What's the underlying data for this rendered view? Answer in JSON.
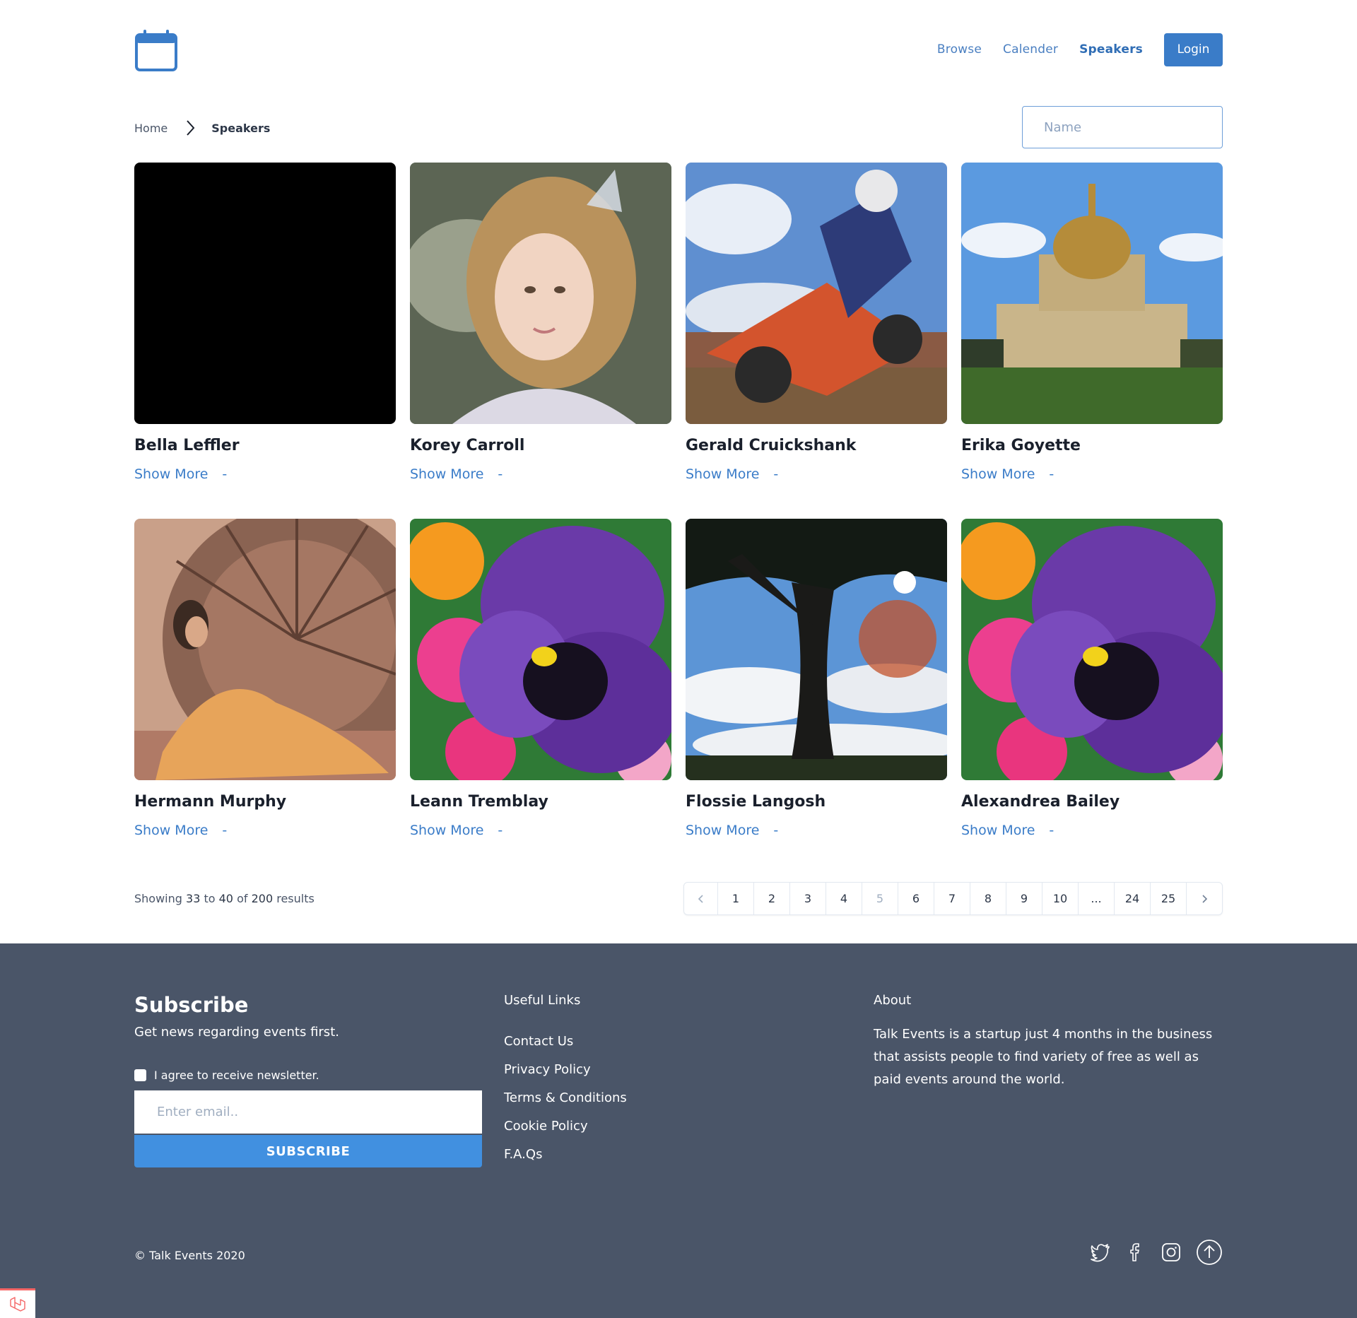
{
  "header": {
    "logo_icon": "calendar-icon",
    "nav": [
      {
        "label": "Browse",
        "active": false
      },
      {
        "label": "Calender",
        "active": false
      },
      {
        "label": "Speakers",
        "active": true
      }
    ],
    "login_label": "Login"
  },
  "breadcrumb": {
    "home": "Home",
    "separator_icon": "chevron-right-icon",
    "current": "Speakers"
  },
  "search": {
    "placeholder": "Name"
  },
  "speakers": [
    {
      "name": "Bella Leffler",
      "link": "Show More",
      "dash": "-"
    },
    {
      "name": "Korey Carroll",
      "link": "Show More",
      "dash": "-"
    },
    {
      "name": "Gerald Cruickshank",
      "link": "Show More",
      "dash": "-"
    },
    {
      "name": "Erika Goyette",
      "link": "Show More",
      "dash": "-"
    },
    {
      "name": "Hermann Murphy",
      "link": "Show More",
      "dash": "-"
    },
    {
      "name": "Leann Tremblay",
      "link": "Show More",
      "dash": "-"
    },
    {
      "name": "Flossie Langosh",
      "link": "Show More",
      "dash": "-"
    },
    {
      "name": "Alexandrea Bailey",
      "link": "Show More",
      "dash": "-"
    }
  ],
  "results": {
    "prefix": "Showing",
    "from": "33",
    "to_word": "to",
    "to": "40",
    "of_word": "of",
    "total": "200",
    "suffix": "results"
  },
  "pagination": {
    "pages": [
      "1",
      "2",
      "3",
      "4",
      "5",
      "6",
      "7",
      "8",
      "9",
      "10",
      "...",
      "24",
      "25"
    ],
    "current": "5"
  },
  "footer": {
    "subscribe_title": "Subscribe",
    "subscribe_desc": "Get news regarding events first.",
    "agree_label": "I agree to receive newsletter.",
    "email_placeholder": "Enter email..",
    "subscribe_button": "SUBSCRIBE",
    "links_title": "Useful Links",
    "links": [
      "Contact Us",
      "Privacy Policy",
      "Terms & Conditions",
      "Cookie Policy",
      "F.A.Qs"
    ],
    "about_title": "About",
    "about_text": "Talk Events is a startup just 4 months in the business that assists people to find variety of free as well as paid events around the world.",
    "copyright": "© Talk Events 2020",
    "social_icons": [
      "twitter-icon",
      "facebook-icon",
      "instagram-icon",
      "arrow-up-circle-icon"
    ]
  },
  "colors": {
    "accent": "#3a7cc8",
    "footer_bg": "#4a5568",
    "subscribe_button": "#4190e0"
  }
}
